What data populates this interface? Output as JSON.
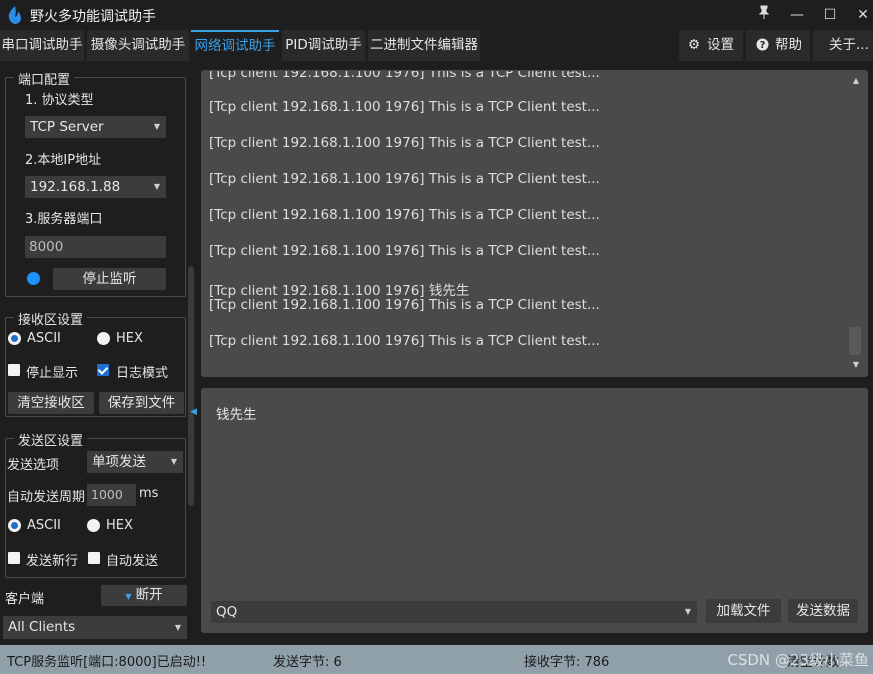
{
  "app": {
    "title": "野火多功能调试助手"
  },
  "window_controls": {
    "pin": "📌",
    "minimize": "—",
    "maximize": "☐",
    "close": "✕"
  },
  "tabs": [
    {
      "label": "串口调试助手"
    },
    {
      "label": "摄像头调试助手"
    },
    {
      "label": "网络调试助手"
    },
    {
      "label": "PID调试助手"
    },
    {
      "label": "二进制文件编辑器"
    }
  ],
  "active_tab": "网络调试助手",
  "toolbar": {
    "settings": "设置",
    "help": "帮助",
    "about": "关于..."
  },
  "port_config": {
    "title": "端口配置",
    "protocol_label": "1. 协议类型",
    "protocol_value": "TCP Server",
    "local_ip_label": "2.本地IP地址",
    "local_ip_value": "192.168.1.88",
    "server_port_label": "3.服务器端口",
    "server_port_value": "8000",
    "stop_listen_button": "停止监听"
  },
  "recv_settings": {
    "title": "接收区设置",
    "ascii": "ASCII",
    "hex": "HEX",
    "ascii_selected": true,
    "stop_display": "停止显示",
    "stop_display_checked": false,
    "log_mode": "日志模式",
    "log_mode_checked": true,
    "clear_button": "清空接收区",
    "save_button": "保存到文件"
  },
  "send_settings": {
    "title": "发送区设置",
    "send_option_label": "发送选项",
    "send_option_value": "单项发送",
    "auto_period_label": "自动发送周期",
    "auto_period_value": "1000",
    "auto_period_unit": "ms",
    "ascii": "ASCII",
    "hex": "HEX",
    "ascii_selected": true,
    "send_newline": "发送新行",
    "send_newline_checked": false,
    "auto_send": "自动发送",
    "auto_send_checked": false
  },
  "client": {
    "label": "客户端",
    "disconnect_button": "断开",
    "clients_value": "All Clients"
  },
  "receive_area": {
    "lines": [
      "[Tcp client 192.168.1.100 1976] This is a TCP Client test...",
      "[Tcp client 192.168.1.100 1976] This is a TCP Client test...",
      "[Tcp client 192.168.1.100 1976] This is a TCP Client test...",
      "[Tcp client 192.168.1.100 1976] This is a TCP Client test...",
      "[Tcp client 192.168.1.100 1976] This is a TCP Client test...",
      "[Tcp client 192.168.1.100 1976] This is a TCP Client test...",
      "[Tcp client 192.168.1.100 1976] 钱先生",
      "[Tcp client 192.168.1.100 1976] This is a TCP Client test...",
      "[Tcp client 192.168.1.100 1976] This is a TCP Client test..."
    ]
  },
  "send_area": {
    "text": "钱先生",
    "history_value": "QQ",
    "load_file_button": "加载文件",
    "send_data_button": "发送数据"
  },
  "status": {
    "listen_status": "TCP服务监听[端口:8000]已启动!!",
    "sent_bytes": "发送字节: 6",
    "recv_bytes": "接收字节: 786",
    "clear_count": "清空计数"
  },
  "watermark": "CSDN @23级小菜鱼",
  "colors": {
    "accent": "#3aa0e8",
    "status_bar": "#8fa0a8",
    "panel": "#4a4a4a"
  }
}
